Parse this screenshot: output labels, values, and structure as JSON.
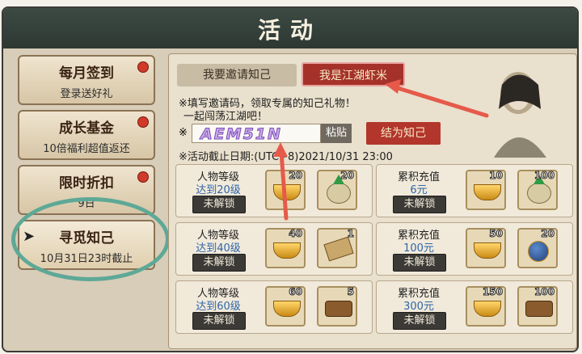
{
  "title": "活动",
  "sidebar": {
    "items": [
      {
        "title": "每月签到",
        "sub": "登录送好礼"
      },
      {
        "title": "成长基金",
        "sub": "10倍福利超值返还"
      },
      {
        "title": "限时折扣",
        "sub": "9日"
      },
      {
        "title": "寻觅知己",
        "sub": "10月31日23时截止"
      }
    ]
  },
  "panel": {
    "tab_invite": "我要邀请知己",
    "tab_me": "我是江湖虾米",
    "note1": "※填写邀请码，领取专属的知己礼物！",
    "note2": "一起闯荡江湖吧！",
    "input_prefix": "※",
    "code": "AEM51N",
    "paste": "粘贴",
    "bind": "结为知己",
    "deadline": "※活动截止日期:(UTC+8)2021/10/31 23:00"
  },
  "cards_left": [
    {
      "h1": "人物等级",
      "h2": "达到20级",
      "lock": "未解锁",
      "n1": "20",
      "n2": "20",
      "icon1": "gold-ingot-icon",
      "icon2": "exp-bag-icon"
    },
    {
      "h1": "人物等级",
      "h2": "达到40级",
      "lock": "未解锁",
      "n1": "40",
      "n2": "1",
      "icon1": "gold-ingot-icon",
      "icon2": "scroll-icon"
    },
    {
      "h1": "人物等级",
      "h2": "达到60级",
      "lock": "未解锁",
      "n1": "60",
      "n2": "5",
      "icon1": "gold-ingot-icon",
      "icon2": "food-icon"
    }
  ],
  "cards_right": [
    {
      "h1": "累积充值",
      "h2": "6元",
      "lock": "未解锁",
      "n1": "10",
      "n2": "100",
      "icon1": "gold-ingot-icon",
      "icon2": "exp-bag-icon"
    },
    {
      "h1": "累积充值",
      "h2": "100元",
      "lock": "未解锁",
      "n1": "50",
      "n2": "20",
      "icon1": "gold-ingot-icon",
      "icon2": "orb-icon"
    },
    {
      "h1": "累积充值",
      "h2": "300元",
      "lock": "未解锁",
      "n1": "150",
      "n2": "100",
      "icon1": "gold-ingot-icon",
      "icon2": "food-icon"
    }
  ],
  "help": "?"
}
